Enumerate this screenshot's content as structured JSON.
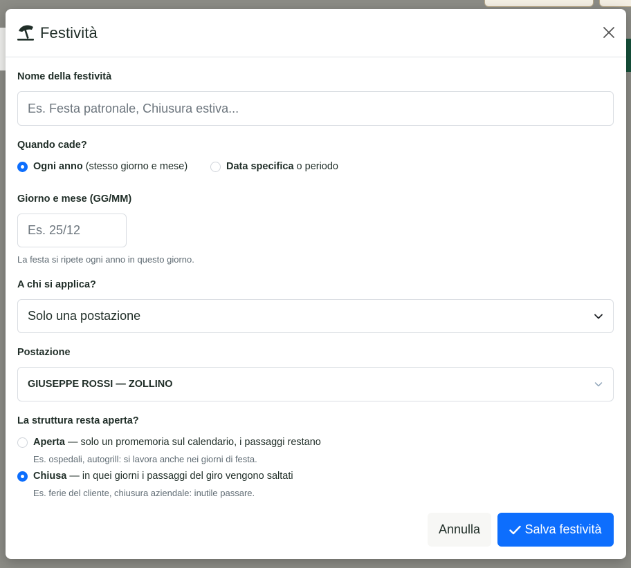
{
  "dialog": {
    "title": "Festività",
    "title_icon": "umbrella-beach-icon",
    "close_icon": "close-icon"
  },
  "name_field": {
    "label": "Nome della festività",
    "placeholder": "Es. Festa patronale, Chiusura estiva...",
    "value": ""
  },
  "when": {
    "label": "Quando cade?",
    "options": [
      {
        "strong": "Ogni anno",
        "rest": "(stesso giorno e mese)",
        "checked": true
      },
      {
        "strong": "Data specifica",
        "rest": "o periodo",
        "checked": false
      }
    ]
  },
  "day_month": {
    "label": "Giorno e mese (GG/MM)",
    "placeholder": "Es. 25/12",
    "value": "",
    "help": "La festa si ripete ogni anno in questo giorno."
  },
  "applies_to": {
    "label": "A chi si applica?",
    "selected": "Solo una postazione"
  },
  "station": {
    "label": "Postazione",
    "selected": "GIUSEPPE ROSSI — ZOLLINO"
  },
  "structure": {
    "label": "La struttura resta aperta?",
    "options": [
      {
        "strong": "Aperta",
        "rest": "— solo un promemoria sul calendario, i passaggi restano",
        "help": "Es. ospedali, autogrill: si lavora anche nei giorni di festa.",
        "checked": false
      },
      {
        "strong": "Chiusa",
        "rest": "— in quei giorni i passaggi del giro vengono saltati",
        "help": "Es. ferie del cliente, chiusura aziendale: inutile passare.",
        "checked": true
      }
    ]
  },
  "footer": {
    "cancel_label": "Annulla",
    "save_label": "Salva festività",
    "save_icon": "check-icon"
  },
  "colors": {
    "primary": "#0d6efd",
    "text": "#1f2d27",
    "muted": "#5f6b73",
    "border": "#d9dde2"
  }
}
